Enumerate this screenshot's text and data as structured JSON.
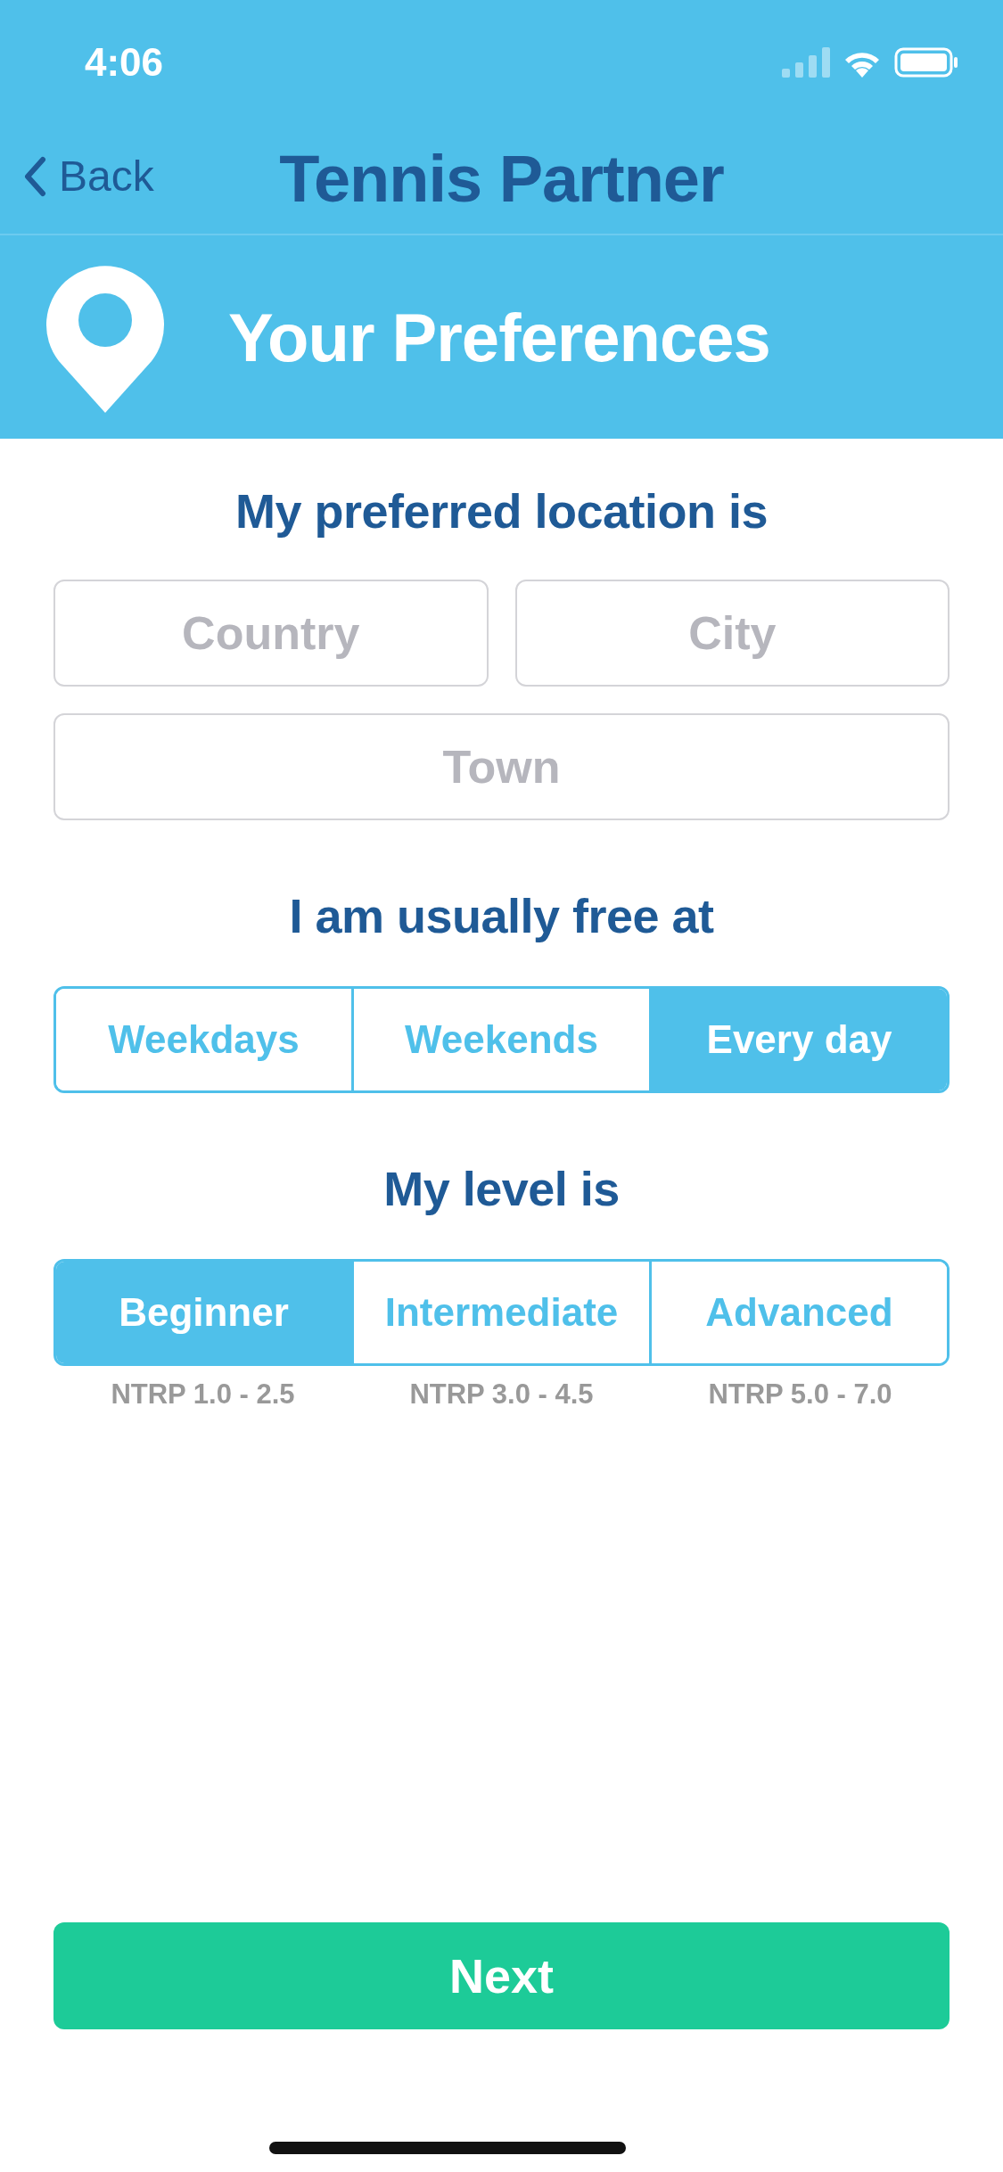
{
  "status_bar": {
    "time": "4:06"
  },
  "nav": {
    "back": "Back",
    "title": "Tennis Partner"
  },
  "header": {
    "title": "Your Preferences"
  },
  "location": {
    "heading": "My preferred location is",
    "fields": [
      {
        "placeholder": "Country"
      },
      {
        "placeholder": "City"
      },
      {
        "placeholder": "Town"
      }
    ]
  },
  "availability": {
    "heading": "I am usually free at",
    "options": [
      {
        "label": "Weekdays",
        "selected": false
      },
      {
        "label": "Weekends",
        "selected": false
      },
      {
        "label": "Every day",
        "selected": true
      }
    ]
  },
  "level": {
    "heading": "My level is",
    "options": [
      {
        "label": "Beginner",
        "selected": true,
        "note": "NTRP 1.0 - 2.5"
      },
      {
        "label": "Intermediate",
        "selected": false,
        "note": "NTRP 3.0 - 4.5"
      },
      {
        "label": "Advanced",
        "selected": false,
        "note": "NTRP 5.0 - 7.0"
      }
    ]
  },
  "next_button": "Next"
}
